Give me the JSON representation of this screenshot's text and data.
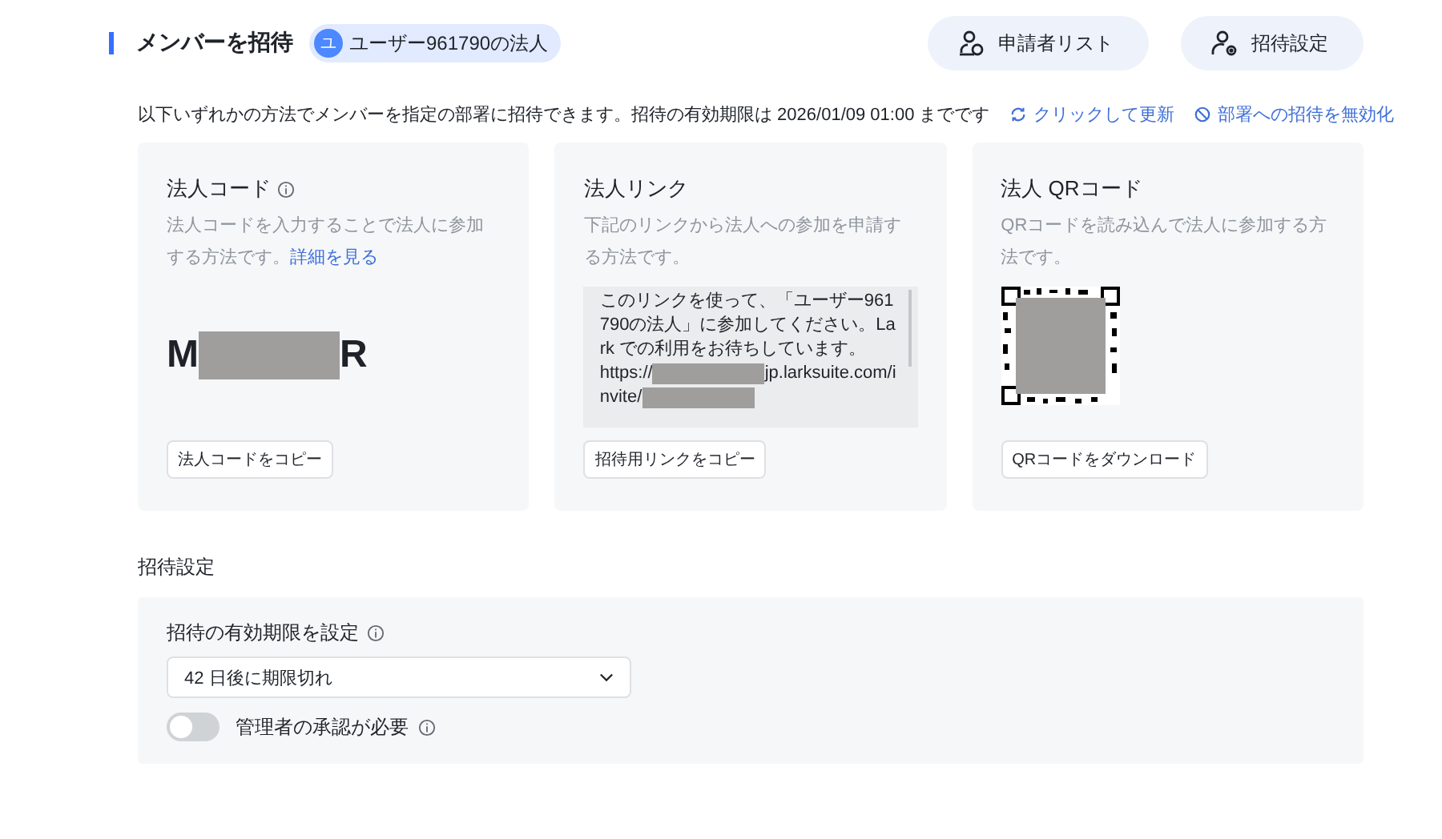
{
  "header": {
    "title": "メンバーを招待",
    "org_badge": {
      "avatar_letter": "ユ",
      "name": "ユーザー961790の法人"
    },
    "buttons": [
      {
        "kind": "applicants",
        "label": "申請者リスト"
      },
      {
        "kind": "settings",
        "label": "招待設定"
      }
    ]
  },
  "notice": {
    "text": "以下いずれかの方法でメンバーを指定の部署に招待できます。招待の有効期限は 2026/01/09 01:00 までです",
    "actions": [
      {
        "kind": "refresh",
        "label": "クリックして更新"
      },
      {
        "kind": "disable",
        "label": "部署への招待を無効化"
      }
    ]
  },
  "cards": [
    {
      "kind": "code",
      "title": "法人コード",
      "description": "法人コードを入力することで法人に参加する方法です。",
      "link": "詳細を見る",
      "code_start": "M",
      "code_end": "R",
      "button": "法人コードをコピー"
    },
    {
      "kind": "link",
      "title": "法人リンク",
      "description": "下記のリンクから法人への参加を申請する方法です。",
      "message": "このリンクを使って、「ユーザー961790の法人」に参加してください。Lark での利用をお待ちしています。",
      "url_start": "https://",
      "url_middle": "jp.larksuite.com/invite/",
      "button": "招待用リンクをコピー"
    },
    {
      "kind": "qr",
      "title": "法人 QRコード",
      "description": "QRコードを読み込んで法人に参加する方法です。",
      "button": "QRコードをダウンロード"
    }
  ],
  "settings": {
    "section_title": "招待設定",
    "expiry": {
      "label": "招待の有効期限を設定",
      "value": "42 日後に期限切れ"
    },
    "approval": {
      "label": "管理者の承認が必要",
      "on": false
    }
  }
}
